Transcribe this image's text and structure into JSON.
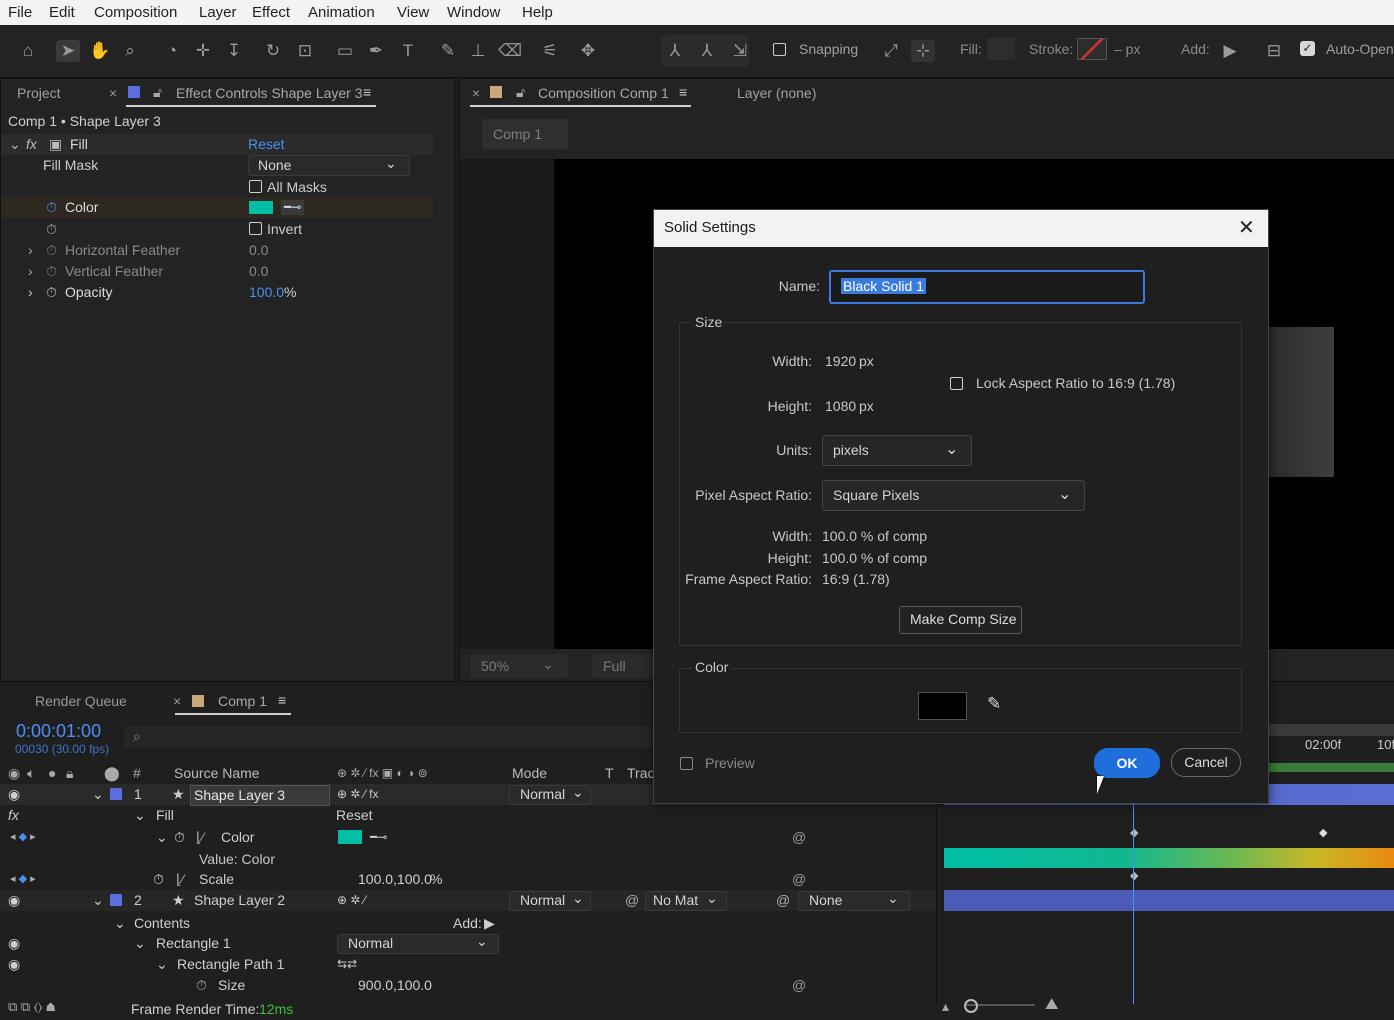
{
  "menubar": {
    "items": [
      "File",
      "Edit",
      "Composition",
      "Layer",
      "Effect",
      "Animation",
      "View",
      "Window",
      "Help"
    ]
  },
  "toolbar": {
    "snapping": "Snapping",
    "fill": "Fill:",
    "stroke": "Stroke:",
    "stroke_unit": "– px",
    "add": "Add:",
    "auto_open": "Auto-Open"
  },
  "project_panel": {
    "tab_project": "Project",
    "tab_effects": "Effect Controls Shape Layer 3",
    "breadcrumb": "Comp 1 • Shape Layer 3"
  },
  "effect": {
    "name": "Fill",
    "reset": "Reset",
    "fill_mask_label": "Fill Mask",
    "fill_mask_value": "None",
    "all_masks": "All Masks",
    "color_label": "Color",
    "color": "#00bfa5",
    "invert": "Invert",
    "h_feather_label": "Horizontal Feather",
    "h_feather": "0.0",
    "v_feather_label": "Vertical Feather",
    "v_feather": "0.0",
    "opacity_label": "Opacity",
    "opacity_value": "100.0",
    "opacity_unit": "%"
  },
  "comp_panel": {
    "tab": "Composition Comp 1",
    "layer_tab": "Layer (none)",
    "crumb": "Comp 1",
    "zoom": "50%",
    "resolution": "Full"
  },
  "timeline": {
    "render_queue": "Render Queue",
    "comp_tab": "Comp 1",
    "timecode": "0:00:01:00",
    "frames": "00030 (30.00 fps)",
    "col_source": "Source Name",
    "col_mode": "Mode",
    "col_t": "T",
    "col_track": "Trac",
    "ruler_label": "02:00f",
    "ruler_label2": "10f",
    "frame_render_label": "Frame Render Time:",
    "frame_render_value": "12ms",
    "layer3": {
      "num": "1",
      "name": "Shape Layer 3",
      "mode": "Normal"
    },
    "fill": "Fill",
    "reset": "Reset",
    "color": "Color",
    "value_color": "Value: Color",
    "scale": "Scale",
    "scale_value": "100.0,100.0",
    "scale_unit": "%",
    "layer2": {
      "num": "2",
      "name": "Shape Layer 2",
      "mode": "Normal",
      "matte": "No Mat",
      "parent": "None"
    },
    "contents": "Contents",
    "add": "Add:",
    "rect1": "Rectangle 1",
    "rect1_mode": "Normal",
    "rectpath": "Rectangle Path 1",
    "size": "Size",
    "size_value": "900.0,100.0"
  },
  "dialog": {
    "title": "Solid Settings",
    "name_label": "Name:",
    "name_value": "Black Solid 1",
    "size_group": "Size",
    "width_label": "Width:",
    "width_value": "1920",
    "width_unit": "px",
    "height_label": "Height:",
    "height_value": "1080",
    "height_unit": "px",
    "lock_aspect": "Lock Aspect Ratio to 16:9 (1.78)",
    "units_label": "Units:",
    "units_value": "pixels",
    "par_label": "Pixel Aspect Ratio:",
    "par_value": "Square Pixels",
    "pct_width_label": "Width:",
    "pct_width_value": "100.0 % of comp",
    "pct_height_label": "Height:",
    "pct_height_value": "100.0 % of comp",
    "far_label": "Frame Aspect Ratio:",
    "far_value": "16:9 (1.78)",
    "make_comp": "Make Comp Size",
    "color_group": "Color",
    "solid_color": "#000000",
    "preview": "Preview",
    "ok": "OK",
    "cancel": "Cancel"
  }
}
